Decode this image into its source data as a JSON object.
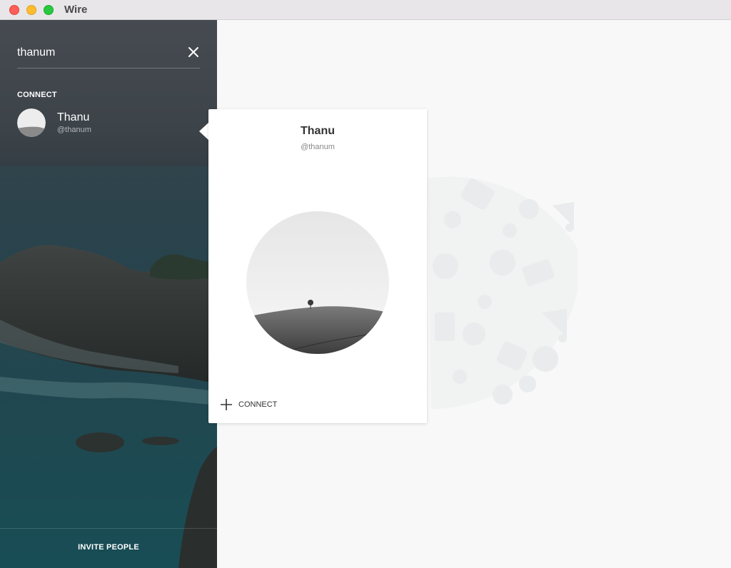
{
  "window": {
    "title": "Wire"
  },
  "search": {
    "value": "thanum",
    "clear_icon": "close-icon"
  },
  "sidebar": {
    "section_label": "CONNECT",
    "results": [
      {
        "name": "Thanu",
        "handle": "@thanum"
      }
    ],
    "invite_label": "INVITE PEOPLE"
  },
  "profile_card": {
    "name": "Thanu",
    "handle": "@thanum",
    "connect_label": "CONNECT",
    "connect_icon": "plus-icon"
  },
  "colors": {
    "titlebar": "#e8e6e8",
    "close": "#fc5f57",
    "minimize": "#fdbc2e",
    "maximize": "#28c840",
    "main_bg": "#f8f8f8"
  }
}
